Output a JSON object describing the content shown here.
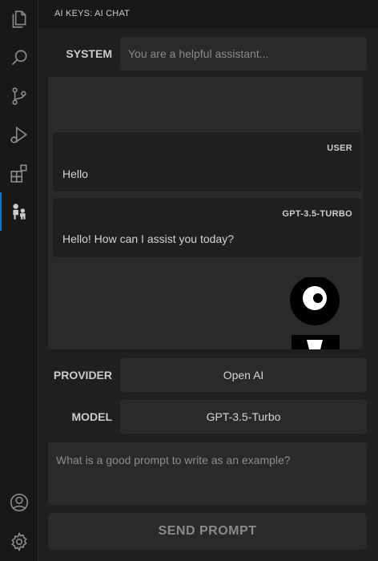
{
  "panel": {
    "title": "AI KEYS: AI CHAT"
  },
  "system": {
    "label": "SYSTEM",
    "placeholder": "You are a helpful assistant..."
  },
  "messages": [
    {
      "role": "USER",
      "text": "Hello"
    },
    {
      "role": "GPT-3.5-TURBO",
      "text": "Hello! How can I assist you today?"
    }
  ],
  "provider": {
    "label": "PROVIDER",
    "value": "Open AI"
  },
  "model": {
    "label": "MODEL",
    "value": "GPT-3.5-Turbo"
  },
  "prompt": {
    "placeholder": "What is a good prompt to write as an example?"
  },
  "send": {
    "label": "SEND PROMPT"
  },
  "activity_bar": {
    "icons": [
      "explorer-icon",
      "search-icon",
      "source-control-icon",
      "run-debug-icon",
      "extensions-icon",
      "ai-keys-icon"
    ],
    "bottom_icons": [
      "account-icon",
      "settings-gear-icon"
    ],
    "active_accent": "#0078d4"
  }
}
